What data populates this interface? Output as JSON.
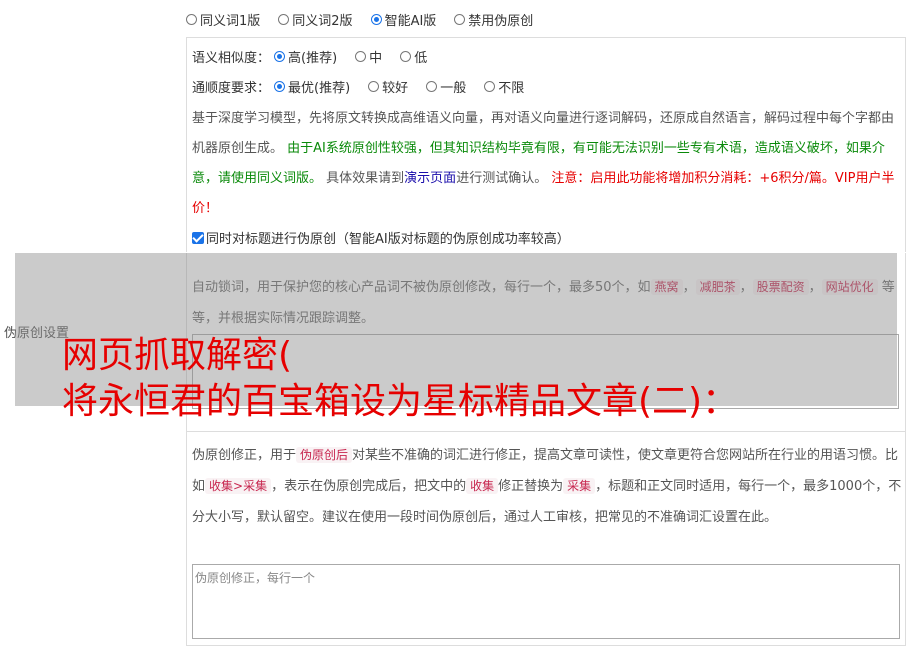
{
  "mode_options": [
    {
      "label": "同义词1版",
      "checked": false
    },
    {
      "label": "同义词2版",
      "checked": false
    },
    {
      "label": "智能AI版",
      "checked": true
    },
    {
      "label": "禁用伪原创",
      "checked": false
    }
  ],
  "similarity": {
    "label": "语义相似度：",
    "options": [
      {
        "label": "高(推荐)",
        "checked": true
      },
      {
        "label": "中",
        "checked": false
      },
      {
        "label": "低",
        "checked": false
      }
    ]
  },
  "fluency": {
    "label": "通顺度要求：",
    "options": [
      {
        "label": "最优(推荐)",
        "checked": true
      },
      {
        "label": "较好",
        "checked": false
      },
      {
        "label": "一般",
        "checked": false
      },
      {
        "label": "不限",
        "checked": false
      }
    ]
  },
  "ai_desc": {
    "p1": "基于深度学习模型，先将原文转换成高维语义向量，再对语义向量进行逐词解码，还原成自然语言，解码过程中每个字都由机器原创生成。",
    "p2_green": "由于AI系统原创性较强，但其知识结构毕竟有限，有可能无法识别一些专有术语，造成语义破坏，如果介意，请使用同义词版。",
    "p3": "具体效果请到",
    "p3_link": "演示页面",
    "p4": "进行测试确认。",
    "p5_red": "注意：启用此功能将增加积分消耗：+6积分/篇。VIP用户半价！"
  },
  "title_checkbox": {
    "label": "同时对标题进行伪原创（智能AI版对标题的伪原创成功率较高）",
    "checked": true
  },
  "lock_words": {
    "desc_a": "自动锁词，用于保护您的核心产品词不被伪原创修改，每行一个，最多50个，如",
    "tags": [
      "燕窝",
      "减肥茶",
      "股票配资",
      "网站优化"
    ],
    "desc_b": "等等，并根据实际情况跟踪调整。"
  },
  "settings_label": "伪原创设置",
  "banner": {
    "line1": "网页抓取解密(",
    "line2": "将永恒君的百宝箱设为星标精品文章(二)："
  },
  "correction": {
    "desc_a": "伪原创修正，用于",
    "tag1": "伪原创后",
    "desc_b": "对某些不准确的词汇进行修正，提高文章可读性，使文章更符合您网站所在行业的用语习惯。比如",
    "tag2": "收集>采集",
    "desc_c": "，表示在伪原创完成后，把文中的",
    "tag3": "收集",
    "desc_d": "修正替换为",
    "tag4": "采集",
    "desc_e": "，标题和正文同时适用，每行一个，最多1000个，不分大小写，默认留空。建议在使用一段时间伪原创后，通过人工审核，把常见的不准确词汇设置在此。",
    "placeholder": "伪原创修正，每行一个"
  }
}
